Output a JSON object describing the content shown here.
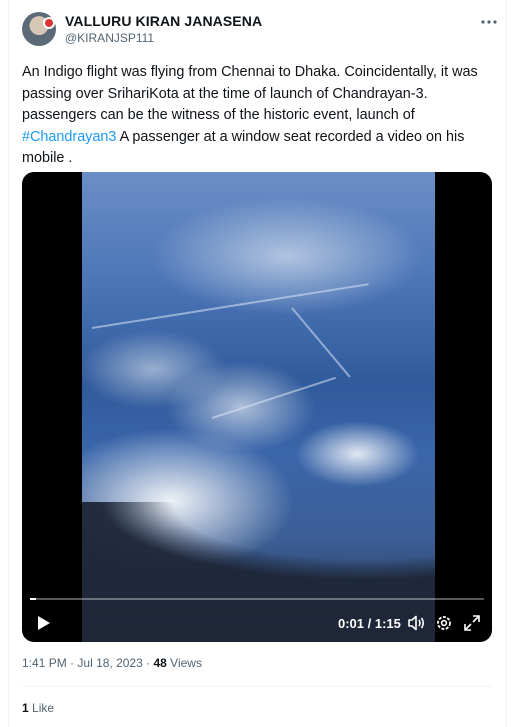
{
  "tweet": {
    "author_name": "VALLURU KIRAN JANASENA",
    "author_handle": "@KIRANJSP111",
    "text_before_hashtag": "An Indigo flight was flying from Chennai to Dhaka. Coincidentally, it was passing over SrihariKota at the time of launch of Chandrayan-3. passengers can be the witness of the historic event, launch of ",
    "hashtag": "#Chandrayan3",
    "text_after_hashtag": " A passenger at a window seat recorded a video on his mobile .",
    "time": "1:41 PM",
    "date_separator": "·",
    "date": "Jul 18, 2023",
    "views_separator": "·",
    "views_count": "48",
    "views_label": "Views",
    "likes_count": "1",
    "likes_label": "Like"
  },
  "video": {
    "time_display": "0:01 / 1:15",
    "progress_fraction": 0.013
  },
  "icons": {
    "more": "more-horizontal-icon",
    "play": "play-icon",
    "volume": "volume-icon",
    "settings": "settings-gear-icon",
    "fullscreen": "fullscreen-icon"
  },
  "colors": {
    "link": "#1d9bf0",
    "secondary_text": "#536471",
    "primary_text": "#0f1419"
  }
}
